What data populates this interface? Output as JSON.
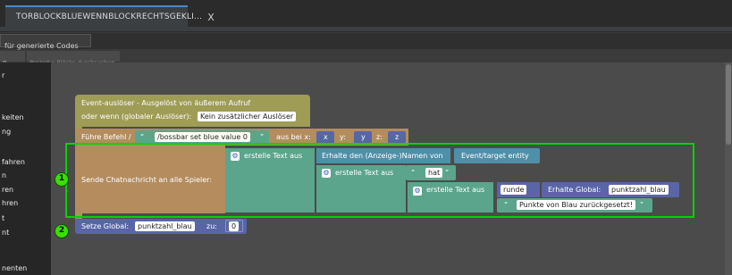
{
  "tab": {
    "title": "TORBLOCKBLUEWENNBLOCKRECHTSGEKLI...",
    "close": "X"
  },
  "toolbar": {
    "generated_label": "für generierte Codes",
    "search_left": "n",
    "search_placeholder": "Prozedur-Blöcke durchsuchen"
  },
  "left_panel": {
    "items": [
      "r",
      "keiten",
      "ng",
      "fahren",
      "n",
      "ren",
      "hren",
      "t",
      "nt",
      "nenten"
    ]
  },
  "blocks": {
    "event_title": "Event-auslöser - Ausgelöst von äußerem Aufruf",
    "event_or": "oder wenn (globaler Auslöser):",
    "trigger_value": "Kein zusätzlicher Auslöser",
    "command_label": "Führe Befehl /",
    "command_value": "/bossbar set blue value 0",
    "at_label": "aus bei x:",
    "x_value": "x",
    "y_label": "y:",
    "y_value": "y",
    "z_label": "z:",
    "z_value": "z",
    "chat_label": "Sende Chatnachricht an alle Spieler:",
    "create_text_1": "erstelle Text aus",
    "display_name_label": "Erhalte den (Anzeige-)Namen von",
    "entity_value": "Event/target entity",
    "create_text_2": "erstelle Text aus",
    "hat_value": "hat",
    "create_text_3": "erstelle Text aus",
    "round_value": "runde",
    "get_global_label": "Erhalte  Global:",
    "global_var": "punktzahl_blau",
    "reset_text": "Punkte von Blau zurückgesetzt!",
    "set_label": "Setze  Global:",
    "set_var": "punktzahl_blau",
    "to_label": "zu:",
    "zero_value": "0"
  },
  "badges": [
    "1",
    "2"
  ],
  "colors": {
    "event": "#9f9c55",
    "command": "#b48c5e",
    "text": "#5ba58c",
    "entity": "#4f8fa8",
    "variable": "#5965a6",
    "highlight": "#00d400"
  }
}
